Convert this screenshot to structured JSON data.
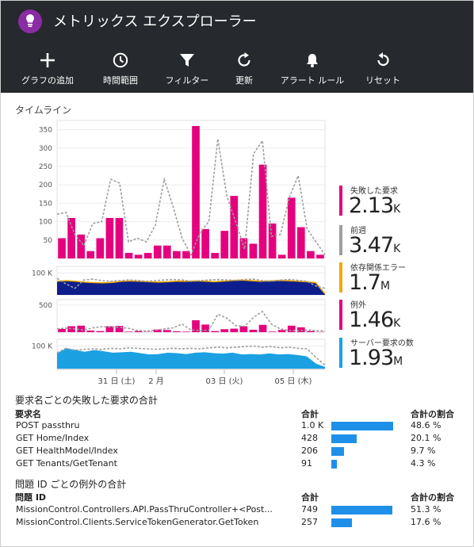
{
  "app": {
    "title": "メトリックス エクスプローラー"
  },
  "toolbar": [
    {
      "label": "グラフの追加",
      "icon": "add-icon"
    },
    {
      "label": "時間範囲",
      "icon": "clock-icon"
    },
    {
      "label": "フィルター",
      "icon": "filter-icon"
    },
    {
      "label": "更新",
      "icon": "refresh-icon"
    },
    {
      "label": "アラート ルール",
      "icon": "bell-icon"
    },
    {
      "label": "リセット",
      "icon": "reset-icon"
    }
  ],
  "timeline": {
    "title": "タイムライン"
  },
  "legend": [
    {
      "label": "失敗した要求",
      "value": "2.13",
      "unit": "K",
      "color": "#e5007d"
    },
    {
      "label": "前週",
      "value": "3.47",
      "unit": "K",
      "color": "#9e9e9e"
    },
    {
      "label": "依存関係エラー",
      "value": "1.7",
      "unit": "M",
      "color": "#f2a900"
    },
    {
      "label": "例外",
      "value": "1.46",
      "unit": "K",
      "color": "#e5007d"
    },
    {
      "label": "サーバー要求の数",
      "value": "1.93",
      "unit": "M",
      "color": "#1ba1e2"
    }
  ],
  "chart_data": [
    {
      "type": "bar",
      "title": "失敗した要求",
      "ylim": [
        0,
        375
      ],
      "yticks": [
        "350",
        "300",
        "250",
        "200",
        "150",
        "100",
        "50"
      ],
      "series": [
        {
          "name": "失敗した要求",
          "type": "bar",
          "color": "#e5007d",
          "values": [
            55,
            110,
            65,
            20,
            55,
            110,
            110,
            15,
            10,
            15,
            35,
            35,
            20,
            20,
            360,
            80,
            15,
            75,
            170,
            55,
            40,
            255,
            95,
            10,
            165,
            85,
            20,
            10
          ]
        },
        {
          "name": "前週",
          "type": "line",
          "style": "dashed",
          "color": "#9e9e9e",
          "values": [
            120,
            125,
            65,
            35,
            95,
            100,
            215,
            205,
            45,
            55,
            45,
            90,
            215,
            140,
            55,
            10,
            70,
            100,
            325,
            170,
            100,
            25,
            285,
            320,
            60,
            65,
            165,
            225,
            80,
            45,
            10
          ]
        }
      ]
    },
    {
      "type": "area",
      "title": "依存関係エラー",
      "ylim": [
        0,
        130
      ],
      "yticks": [
        "100 K"
      ],
      "series": [
        {
          "name": "依存関係エラー",
          "type": "area",
          "color": "#f2a900",
          "fill": "#0d1e8c",
          "values": [
            62,
            65,
            62,
            58,
            56,
            55,
            57,
            62,
            64,
            62,
            60,
            58,
            60,
            63,
            62,
            64,
            63,
            60,
            63,
            66,
            68,
            65,
            62,
            64,
            66,
            65,
            63,
            60,
            56,
            5
          ]
        },
        {
          "name": "前週",
          "type": "line",
          "style": "dashed",
          "color": "#9e9e9e",
          "values": [
            75,
            50,
            30,
            68,
            72,
            65,
            62,
            65,
            68,
            66,
            62,
            65,
            68,
            70,
            68,
            62,
            65,
            68,
            70,
            68,
            66,
            70,
            72,
            65,
            62,
            68,
            70,
            66,
            62,
            40,
            30
          ]
        }
      ]
    },
    {
      "type": "bar",
      "title": "例外",
      "ylim": [
        0,
        600
      ],
      "yticks": [
        "500"
      ],
      "series": [
        {
          "name": "例外",
          "type": "bar",
          "color": "#e5007d",
          "values": [
            60,
            110,
            120,
            30,
            20,
            110,
            115,
            10,
            20,
            5,
            50,
            40,
            15,
            10,
            220,
            140,
            20,
            55,
            65,
            110,
            45,
            135,
            10,
            40,
            120,
            90,
            20,
            5
          ]
        },
        {
          "name": "前週",
          "type": "line",
          "style": "dashed",
          "color": "#9e9e9e",
          "values": [
            60,
            75,
            60,
            40,
            80,
            100,
            95,
            90,
            70,
            30,
            20,
            35,
            60,
            80,
            150,
            40,
            30,
            35,
            330,
            260,
            120,
            110,
            275,
            380,
            150,
            60,
            30,
            25,
            40,
            30,
            20
          ]
        }
      ]
    },
    {
      "type": "area",
      "title": "サーバー要求の数",
      "ylim": [
        0,
        130
      ],
      "yticks": [
        "100 K"
      ],
      "series": [
        {
          "name": "サーバー要求の数",
          "type": "area",
          "color": "#1ba1e2",
          "fill": "#1ba1e2",
          "values": [
            65,
            88,
            80,
            72,
            80,
            75,
            68,
            70,
            72,
            66,
            60,
            62,
            68,
            66,
            62,
            68,
            70,
            66,
            64,
            68,
            60,
            62,
            60,
            65,
            60,
            62,
            58,
            52,
            20,
            5
          ]
        },
        {
          "name": "前週",
          "type": "line",
          "style": "dashed",
          "color": "#9e9e9e",
          "values": [
            70,
            90,
            82,
            85,
            88,
            85,
            90,
            88,
            92,
            90,
            88,
            86,
            88,
            90,
            88,
            90,
            88,
            92,
            95,
            92,
            95,
            98,
            100,
            95,
            98,
            92,
            95,
            90,
            88,
            50,
            15
          ]
        }
      ]
    }
  ],
  "xaxis": {
    "labels": [
      "31 日 (土)",
      "2 月",
      "03 日 (火)",
      "05 日 (木)"
    ]
  },
  "table1": {
    "title": "要求名ごとの失敗した要求の合計",
    "headers": {
      "name": "要求名",
      "count": "合計",
      "pct": "合計の割合"
    },
    "rows": [
      {
        "name": "POST passthru",
        "count": "1.0 K",
        "pct": "48.6 %",
        "share": 0.486
      },
      {
        "name": "GET Home/Index",
        "count": "428",
        "pct": "20.1 %",
        "share": 0.201
      },
      {
        "name": "GET HealthModel/Index",
        "count": "206",
        "pct": "9.7 %",
        "share": 0.097
      },
      {
        "name": "GET Tenants/GetTenant",
        "count": "91",
        "pct": "4.3 %",
        "share": 0.043
      }
    ]
  },
  "table2": {
    "title": "問題 ID ごとの例外の合計",
    "headers": {
      "name": "問題 ID",
      "count": "合計",
      "pct": "合計の割合"
    },
    "rows": [
      {
        "name": "MissionControl.Controllers.API.PassThruController+<Post...",
        "count": "749",
        "pct": "51.3 %",
        "share": 0.513
      },
      {
        "name": "MissionControl.Clients.ServiceTokenGenerator.GetToken",
        "count": "257",
        "pct": "17.6 %",
        "share": 0.176
      }
    ]
  }
}
